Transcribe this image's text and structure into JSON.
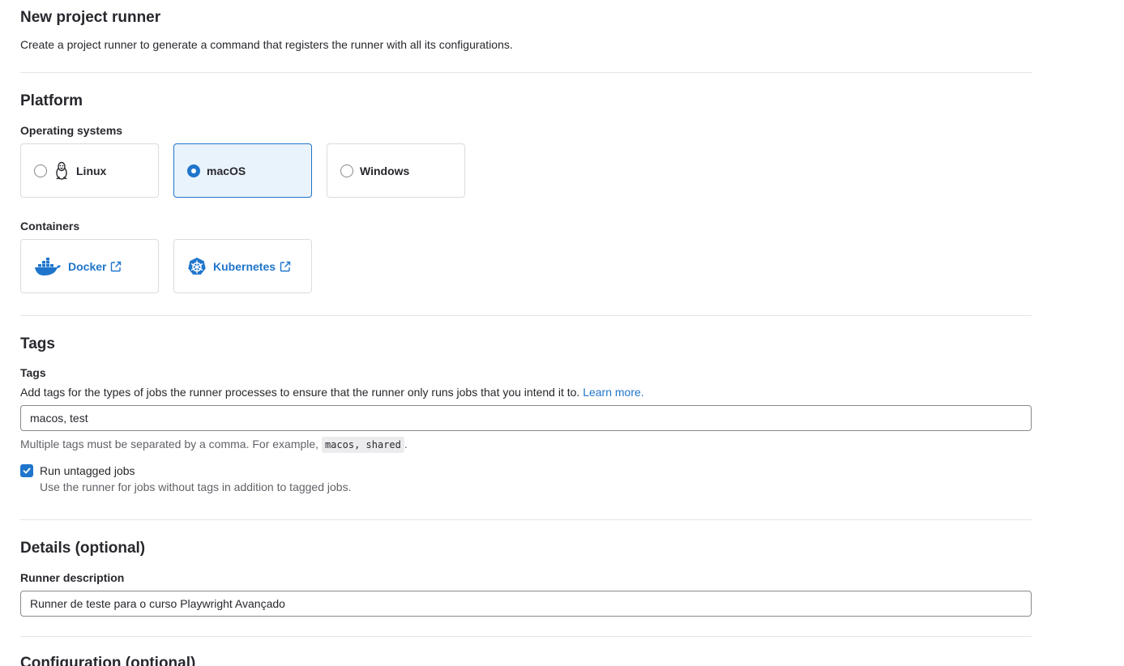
{
  "header": {
    "title": "New project runner",
    "description": "Create a project runner to generate a command that registers the runner with all its configurations."
  },
  "platform": {
    "section_title": "Platform",
    "os_label": "Operating systems",
    "os_options": [
      {
        "label": "Linux",
        "selected": false,
        "icon": "linux-penguin-icon"
      },
      {
        "label": "macOS",
        "selected": true
      },
      {
        "label": "Windows",
        "selected": false
      }
    ],
    "containers_label": "Containers",
    "containers": [
      {
        "label": "Docker",
        "icon": "docker-icon"
      },
      {
        "label": "Kubernetes",
        "icon": "kubernetes-icon"
      }
    ]
  },
  "tags": {
    "section_title": "Tags",
    "field_label": "Tags",
    "help": "Add tags for the types of jobs the runner processes to ensure that the runner only runs jobs that you intend it to.",
    "learn_more": "Learn more.",
    "value": "macos, test",
    "hint_prefix": "Multiple tags must be separated by a comma. For example,",
    "hint_code": "macos, shared",
    "hint_suffix": ".",
    "untagged_label": "Run untagged jobs",
    "untagged_checked": true,
    "untagged_help": "Use the runner for jobs without tags in addition to tagged jobs."
  },
  "details": {
    "section_title": "Details (optional)",
    "description_label": "Runner description",
    "description_value": "Runner de teste para o curso Playwright Avançado"
  },
  "configuration": {
    "section_title": "Configuration (optional)"
  },
  "colors": {
    "accent": "#1f75cb",
    "selected_bg": "#e9f3fc",
    "text": "#28272d",
    "muted": "#626168",
    "border": "#dcdcde"
  }
}
